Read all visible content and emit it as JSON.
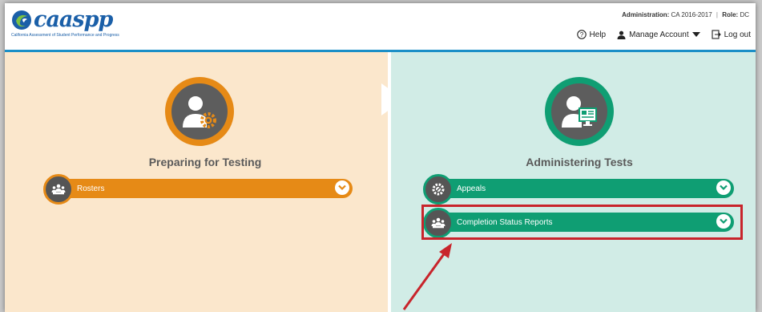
{
  "header": {
    "logo_text": "caaspp",
    "logo_subtitle": "California Assessment of Student Performance and Progress",
    "administration_label": "Administration:",
    "administration_value": "CA 2016-2017",
    "role_label": "Role:",
    "role_value": "DC",
    "help_label": "Help",
    "manage_account_label": "Manage Account",
    "logout_label": "Log out"
  },
  "left_panel": {
    "title": "Preparing for Testing",
    "icon": "user-gear-icon",
    "items": [
      {
        "label": "Rosters",
        "icon": "people-group-icon"
      }
    ]
  },
  "right_panel": {
    "title": "Administering Tests",
    "icon": "user-monitor-icon",
    "items": [
      {
        "label": "Appeals",
        "icon": "gear-badge-icon"
      },
      {
        "label": "Completion Status Reports",
        "icon": "people-group-icon",
        "highlighted": true
      }
    ]
  },
  "colors": {
    "orange": "#e68a16",
    "green": "#0f9e73",
    "left_bg": "#fbe7cc",
    "right_bg": "#d1ece6",
    "highlight": "#c8242b",
    "header_rule": "#1b8fc7"
  }
}
